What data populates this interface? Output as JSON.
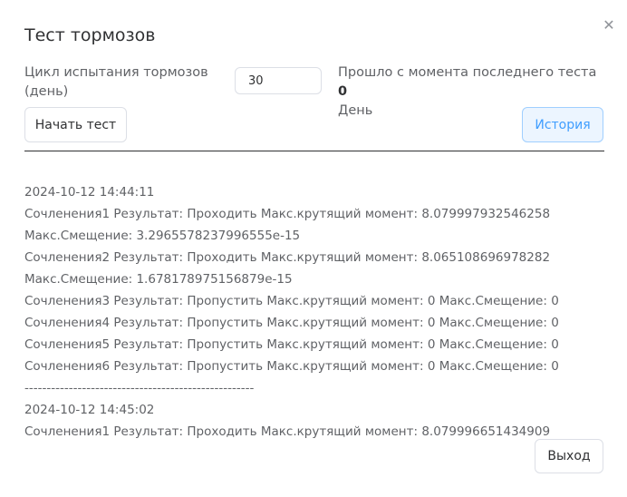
{
  "dialog": {
    "title": "Тест тормозов",
    "close_icon": "close-icon"
  },
  "form": {
    "cycle_label": "Цикл испытания тормозов (день)",
    "cycle_value": "30",
    "since_label": "Прошло с момента последнего теста",
    "since_value": "0",
    "since_unit": "День"
  },
  "buttons": {
    "start": "Начать тест",
    "history": "История",
    "exit": "Выход"
  },
  "log": [
    "2024-10-12 14:44:11",
    "Сочленения1 Результат: Проходить Макс.крутящий момент: 8.079997932546258",
    "Макс.Смещение: 3.2965578237996555e-15",
    "Сочленения2 Результат: Проходить Макс.крутящий момент: 8.065108696978282",
    "Макс.Смещение: 1.678178975156879e-15",
    "Сочленения3 Результат: Пропустить Макс.крутящий момент: 0 Макс.Смещение: 0",
    "Сочленения4 Результат: Пропустить Макс.крутящий момент: 0 Макс.Смещение: 0",
    "Сочленения5 Результат: Пропустить Макс.крутящий момент: 0 Макс.Смещение: 0",
    "Сочленения6 Результат: Пропустить Макс.крутящий момент: 0 Макс.Смещение: 0",
    "----------------------------------------------------",
    "2024-10-12 14:45:02",
    "Сочленения1 Результат: Проходить Макс.крутящий момент: 8.079996651434909"
  ],
  "colors": {
    "primary": "#409eff",
    "primary_bg": "#ecf5ff",
    "border": "#dcdfe6",
    "text": "#303133",
    "secondary_text": "#606266"
  }
}
